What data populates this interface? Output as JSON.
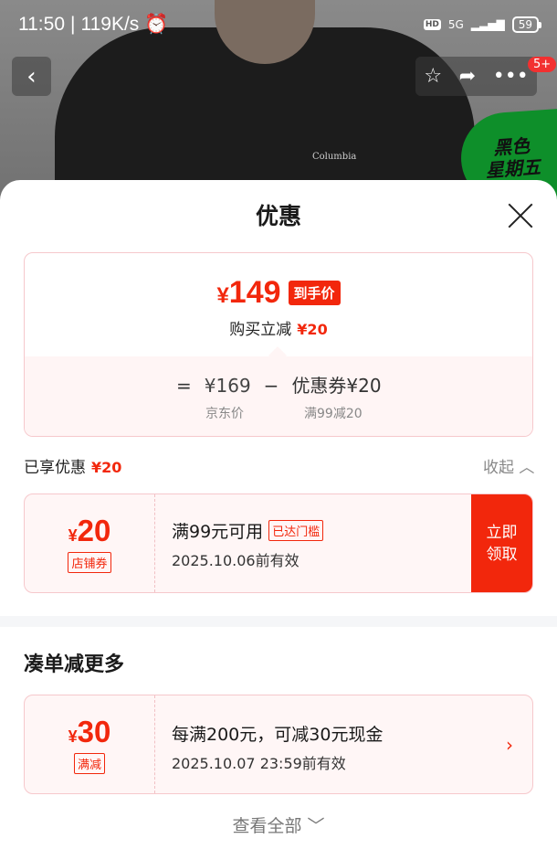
{
  "status_bar": {
    "time": "11:50",
    "speed": "119K/s",
    "hd": "HD",
    "network": "5G",
    "battery": "59"
  },
  "background": {
    "shirt_logo": "Columbia",
    "promo_line1": "黑色",
    "promo_line2": "星期五"
  },
  "nav": {
    "back_icon": "chevron-left-icon",
    "badge": "5+"
  },
  "sheet": {
    "title": "优惠",
    "price_card": {
      "currency": "¥",
      "final_price": "149",
      "final_tag": "到手价",
      "buy_save_label": "购买立减",
      "buy_save_value": "¥20",
      "eq": "=",
      "jd_price": "¥169",
      "minus": "−",
      "coupon_label": "优惠券¥20",
      "jd_price_label": "京东价",
      "coupon_cond": "满99减20"
    },
    "enjoyed_label": "已享优惠",
    "enjoyed_value": "¥20",
    "collapse_label": "收起",
    "coupon": {
      "currency": "¥",
      "amount": "20",
      "tag": "店铺券",
      "condition": "满99元可用",
      "met_badge": "已达门槛",
      "validity": "2025.10.06前有效",
      "claim_line1": "立即",
      "claim_line2": "领取"
    },
    "more_section_title": "凑单减更多",
    "discount": {
      "currency": "¥",
      "amount": "30",
      "tag": "满减",
      "description": "每满200元，可减30元现金",
      "validity": "2025.10.07 23:59前有效"
    },
    "view_all": "查看全部"
  },
  "colors": {
    "accent": "#f2270c",
    "card_border": "#f6c8cc",
    "card_bg": "#fff6f6"
  }
}
